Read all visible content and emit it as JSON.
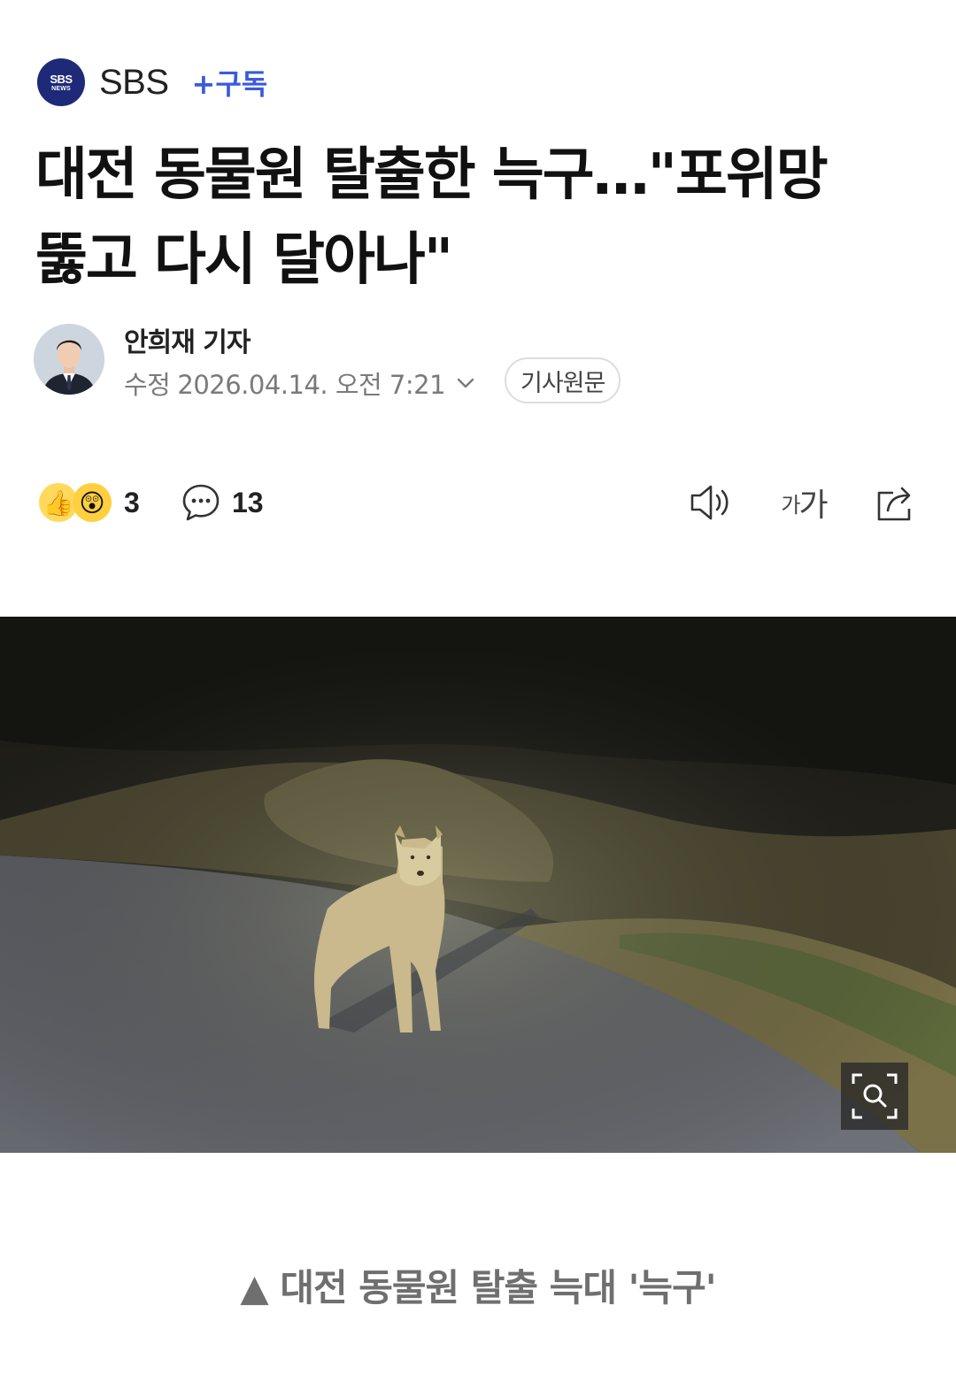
{
  "press": {
    "logo_line1": "SBS",
    "logo_line2": "NEWS",
    "name": "SBS",
    "subscribe_label": "+구독"
  },
  "article": {
    "headline_line1": "대전 동물원 탈출한 늑구…\"포위망",
    "headline_line2": "뚫고 다시 달아나\"",
    "reporter": "안희재 기자",
    "date_label": "수정",
    "date": "2026.04.14. 오전 7:21",
    "original_button": "기사원문"
  },
  "actions": {
    "reactions_count": "3",
    "comments_count": "13",
    "font_tool_label_small": "가",
    "font_tool_label_large": "가"
  },
  "photo": {
    "caption": "▲ 대전 동물원 탈출 늑대 '늑구'"
  },
  "icons": {
    "reaction_thumb": "thumbs-up-icon",
    "reaction_wow": "surprised-face-icon",
    "comment": "speech-bubble-icon",
    "speaker": "speaker-icon",
    "share": "share-icon",
    "zoom": "magnifier-icon"
  },
  "colors": {
    "brand": "#1e2a78",
    "subscribe": "#3b5bdb",
    "caption": "#6f6f6f"
  }
}
